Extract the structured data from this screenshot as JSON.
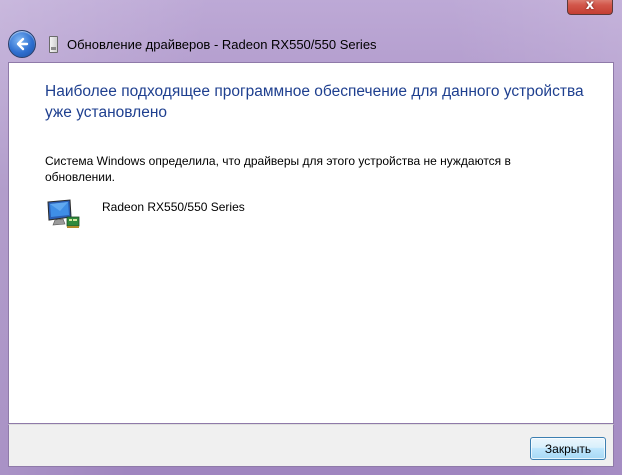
{
  "window": {
    "title": "Обновление драйверов - Radeon RX550/550 Series",
    "close_glyph": "x"
  },
  "main": {
    "heading": "Наиболее подходящее программное обеспечение для данного устройства уже установлено",
    "description": "Система Windows определила, что драйверы для этого устройства не нуждаются в обновлении.",
    "device_name": "Radeon RX550/550 Series"
  },
  "footer": {
    "close_label": "Закрыть"
  },
  "colors": {
    "heading": "#1e3f8f",
    "frame": "#a58cc2"
  },
  "icons": {
    "back": "back-arrow-icon",
    "device": "monitor-icon",
    "title_device": "device-icon"
  }
}
